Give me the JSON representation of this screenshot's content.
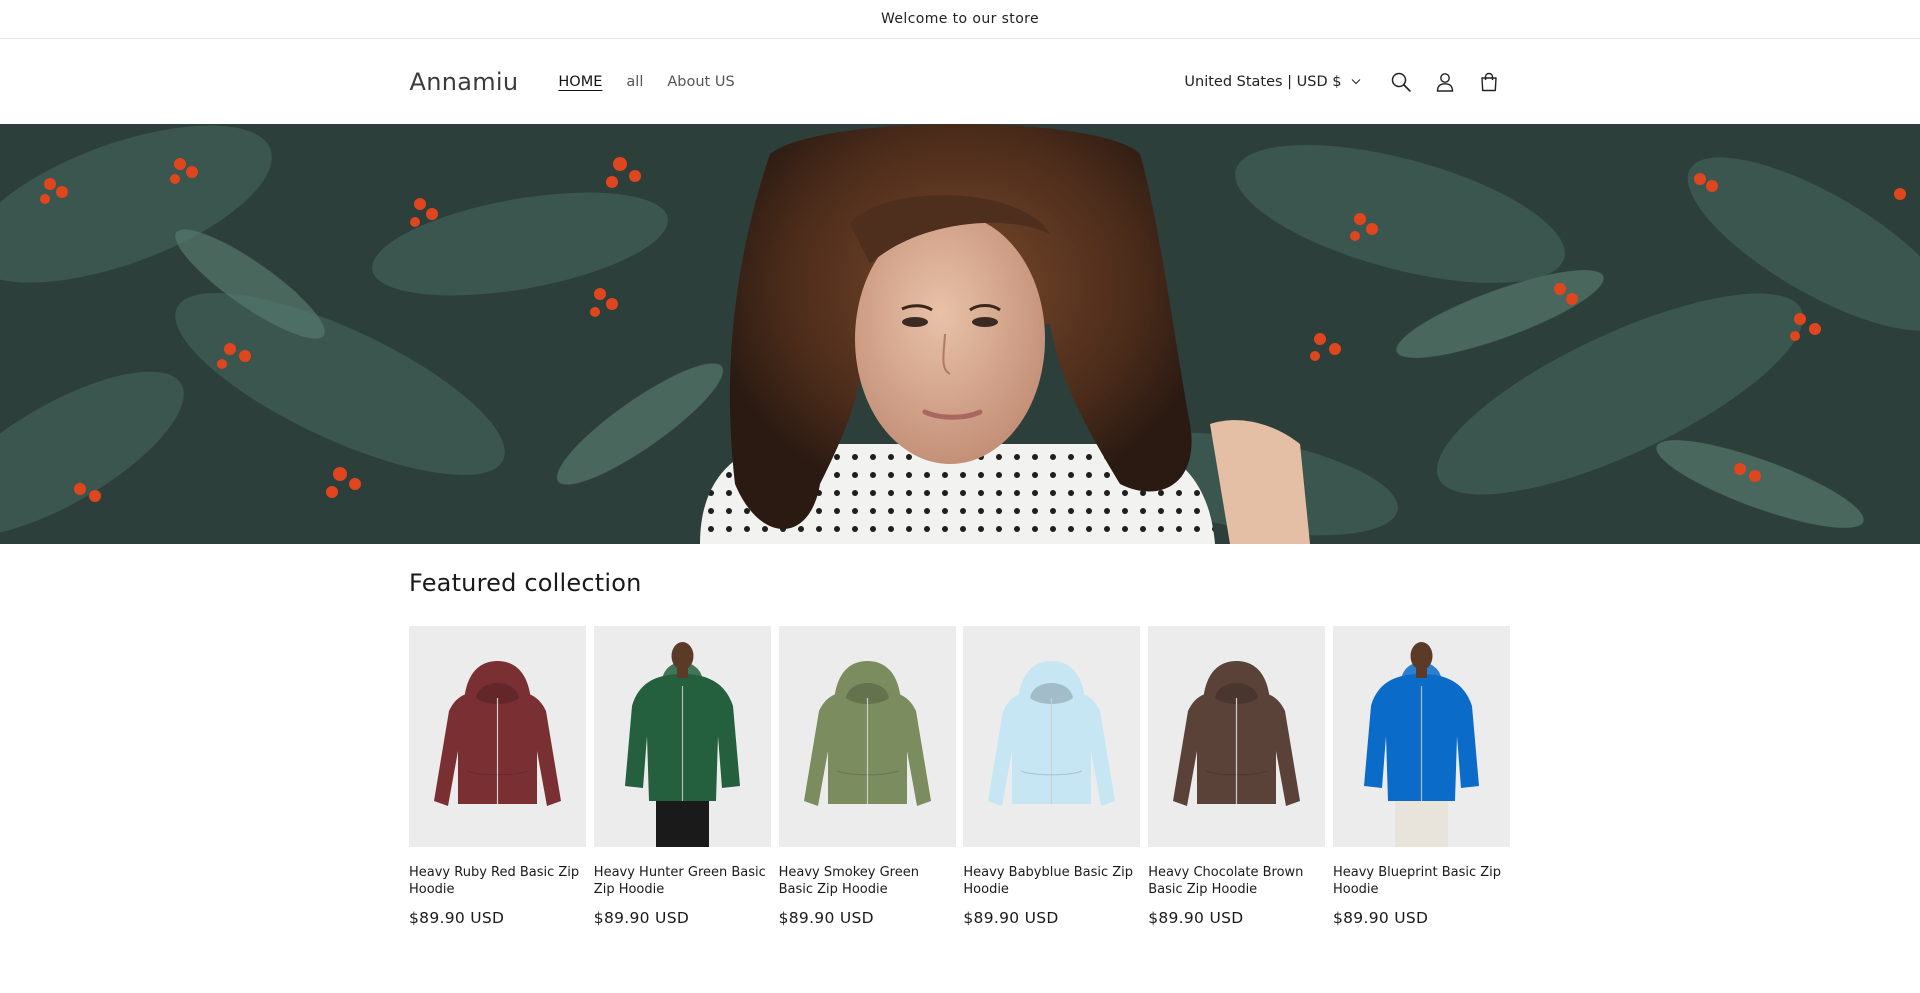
{
  "announcement": {
    "text": "Welcome to our store"
  },
  "header": {
    "logo": "Annamiu",
    "nav": [
      {
        "label": "HOME",
        "active": true
      },
      {
        "label": "all",
        "active": false
      },
      {
        "label": "About US",
        "active": false
      }
    ],
    "country_selector": "United States | USD $",
    "icons": [
      "search-icon",
      "account-icon",
      "cart-icon"
    ]
  },
  "featured": {
    "heading": "Featured collection",
    "products": [
      {
        "title": "Heavy Ruby Red Basic Zip Hoodie",
        "price": "$89.90 USD",
        "color": "#7a3033",
        "model": false
      },
      {
        "title": "Heavy Hunter Green Basic Zip Hoodie",
        "price": "$89.90 USD",
        "color": "#245f3e",
        "model": true
      },
      {
        "title": "Heavy Smokey Green Basic Zip Hoodie",
        "price": "$89.90 USD",
        "color": "#7b8c5e",
        "model": false
      },
      {
        "title": "Heavy Babyblue Basic Zip Hoodie",
        "price": "$89.90 USD",
        "color": "#c6e6f4",
        "model": false
      },
      {
        "title": "Heavy Chocolate Brown Basic Zip Hoodie",
        "price": "$89.90 USD",
        "color": "#5a4239",
        "model": false
      },
      {
        "title": "Heavy Blueprint Basic Zip Hoodie",
        "price": "$89.90 USD",
        "color": "#0a6bc9",
        "model": true
      }
    ]
  }
}
